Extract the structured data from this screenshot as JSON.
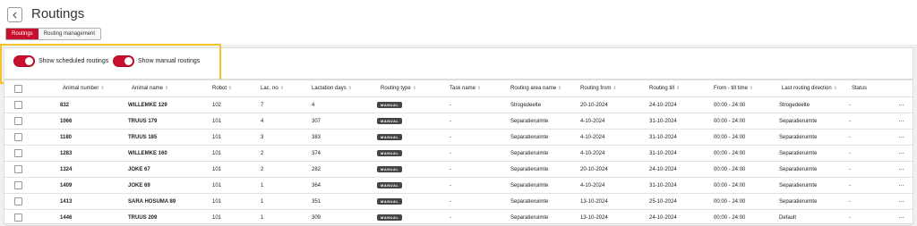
{
  "header": {
    "title": "Routings",
    "tabs": [
      {
        "label": "Routings",
        "active": true
      },
      {
        "label": "Routing management",
        "active": false
      }
    ]
  },
  "filters": {
    "scheduled_label": "Show scheduled routings",
    "scheduled_on": true,
    "manual_label": "Show manual routings",
    "manual_on": true
  },
  "table": {
    "columns": [
      "Animal number",
      "Animal name",
      "Robot",
      "Lac. no",
      "Lactation days",
      "Routing type",
      "Task name",
      "Routing area name",
      "Routing from",
      "Routing till",
      "From - till time",
      "Last routing direction",
      "Status"
    ],
    "rows": [
      {
        "animal_number": "832",
        "animal_name": "WILLEMKE 129",
        "robot": "102",
        "lac_no": "7",
        "lactation_days": "4",
        "routing_type": "MANUAL",
        "task_name": "-",
        "area": "Strogedeelte",
        "from": "20-10-2024",
        "till": "24-10-2024",
        "time": "00:00 - 24:00",
        "direction": "Strogedeelte",
        "status": "-"
      },
      {
        "animal_number": "1066",
        "animal_name": "TRUUS 179",
        "robot": "101",
        "lac_no": "4",
        "lactation_days": "307",
        "routing_type": "MANUAL",
        "task_name": "-",
        "area": "Separatieruimte",
        "from": "4-10-2024",
        "till": "31-10-2024",
        "time": "00:00 - 24:00",
        "direction": "Separatieruimte",
        "status": "-"
      },
      {
        "animal_number": "1180",
        "animal_name": "TRUUS 185",
        "robot": "101",
        "lac_no": "3",
        "lactation_days": "383",
        "routing_type": "MANUAL",
        "task_name": "-",
        "area": "Separatieruimte",
        "from": "4-10-2024",
        "till": "31-10-2024",
        "time": "00:00 - 24:00",
        "direction": "Separatieruimte",
        "status": "-"
      },
      {
        "animal_number": "1283",
        "animal_name": "WILLEMKE 160",
        "robot": "101",
        "lac_no": "2",
        "lactation_days": "374",
        "routing_type": "MANUAL",
        "task_name": "-",
        "area": "Separatieruimte",
        "from": "4-10-2024",
        "till": "31-10-2024",
        "time": "00:00 - 24:00",
        "direction": "Separatieruimte",
        "status": "-"
      },
      {
        "animal_number": "1324",
        "animal_name": "JOKE 67",
        "robot": "101",
        "lac_no": "2",
        "lactation_days": "282",
        "routing_type": "MANUAL",
        "task_name": "-",
        "area": "Separatieruimte",
        "from": "20-10-2024",
        "till": "24-10-2024",
        "time": "00:00 - 24:00",
        "direction": "Separatieruimte",
        "status": "-"
      },
      {
        "animal_number": "1409",
        "animal_name": "JOKE 69",
        "robot": "101",
        "lac_no": "1",
        "lactation_days": "364",
        "routing_type": "MANUAL",
        "task_name": "-",
        "area": "Separatieruimte",
        "from": "4-10-2024",
        "till": "31-10-2024",
        "time": "00:00 - 24:00",
        "direction": "Separatieruimte",
        "status": "-"
      },
      {
        "animal_number": "1413",
        "animal_name": "SARA HOSUMA 89",
        "robot": "101",
        "lac_no": "1",
        "lactation_days": "351",
        "routing_type": "MANUAL",
        "task_name": "-",
        "area": "Separatieruimte",
        "from": "13-10-2024",
        "till": "25-10-2024",
        "time": "00:00 - 24:00",
        "direction": "Separatieruimte",
        "status": "-"
      },
      {
        "animal_number": "1446",
        "animal_name": "TRUUS 209",
        "robot": "101",
        "lac_no": "1",
        "lactation_days": "309",
        "routing_type": "MANUAL",
        "task_name": "-",
        "area": "Separatieruimte",
        "from": "13-10-2024",
        "till": "24-10-2024",
        "time": "00:00 - 24:00",
        "direction": "Default",
        "status": "-"
      }
    ],
    "more_label": "···",
    "sort_glyph": "⇕"
  },
  "colors": {
    "accent": "#c8102e",
    "highlight": "#f2c230"
  }
}
